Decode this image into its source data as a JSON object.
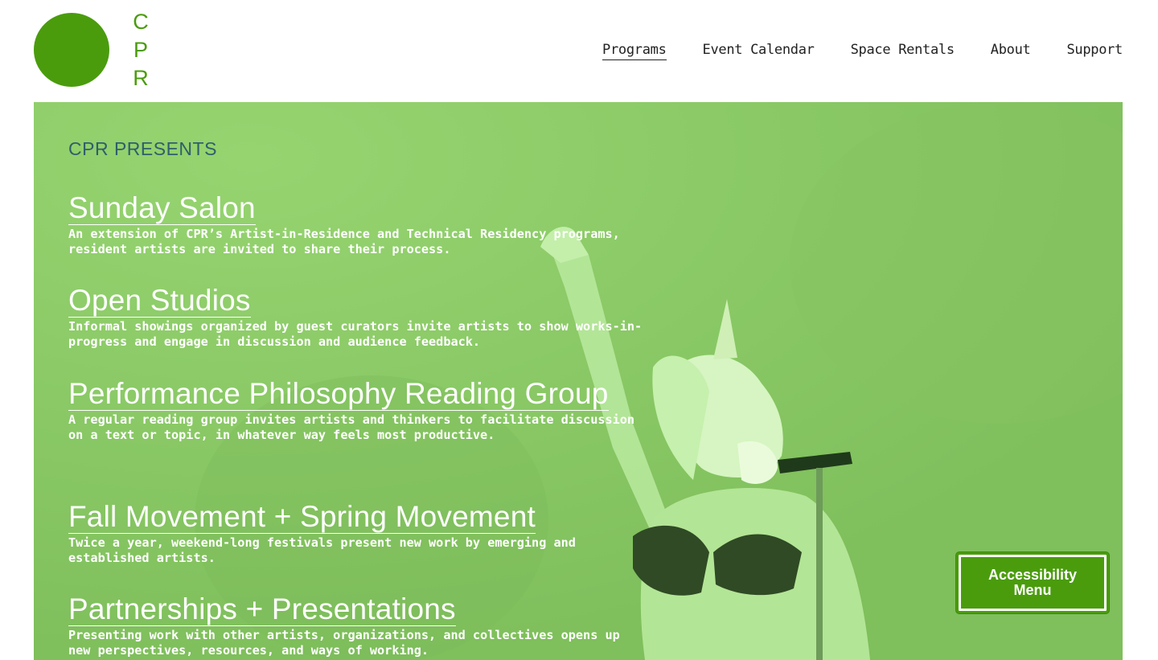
{
  "logo": {
    "letters": [
      "C",
      "P",
      "R"
    ]
  },
  "nav": {
    "items": [
      {
        "label": "Programs",
        "active": true
      },
      {
        "label": "Event Calendar",
        "active": false
      },
      {
        "label": "Space Rentals",
        "active": false
      },
      {
        "label": "About",
        "active": false
      },
      {
        "label": "Support",
        "active": false
      }
    ]
  },
  "hero": {
    "eyebrow": "CPR PRESENTS",
    "programs": [
      {
        "title": "Sunday Salon",
        "description": "An extension of CPR’s Artist-in-Residence and Technical Residency programs, resident artists are invited to share their process."
      },
      {
        "title": "Open Studios",
        "description": "Informal showings organized by guest curators invite artists to show works-in-progress and engage in discussion and audience feedback."
      },
      {
        "title": "Performance Philosophy Reading Group",
        "description": "A regular reading group invites artists and thinkers to facilitate discussion on a text or topic, in whatever way feels most productive."
      },
      {
        "title": "Fall Movement + Spring Movement",
        "description": "Twice a year, weekend-long festivals present new work by emerging and established artists."
      },
      {
        "title": "Partnerships + Presentations",
        "description": "Presenting work with other artists, organizations, and collectives opens up new perspectives, resources, and ways of working."
      }
    ]
  },
  "accessibility": {
    "label": "Accessibility Menu"
  },
  "colors": {
    "brand_green": "#4a9c0d",
    "hero_green": "#8ccc68"
  }
}
